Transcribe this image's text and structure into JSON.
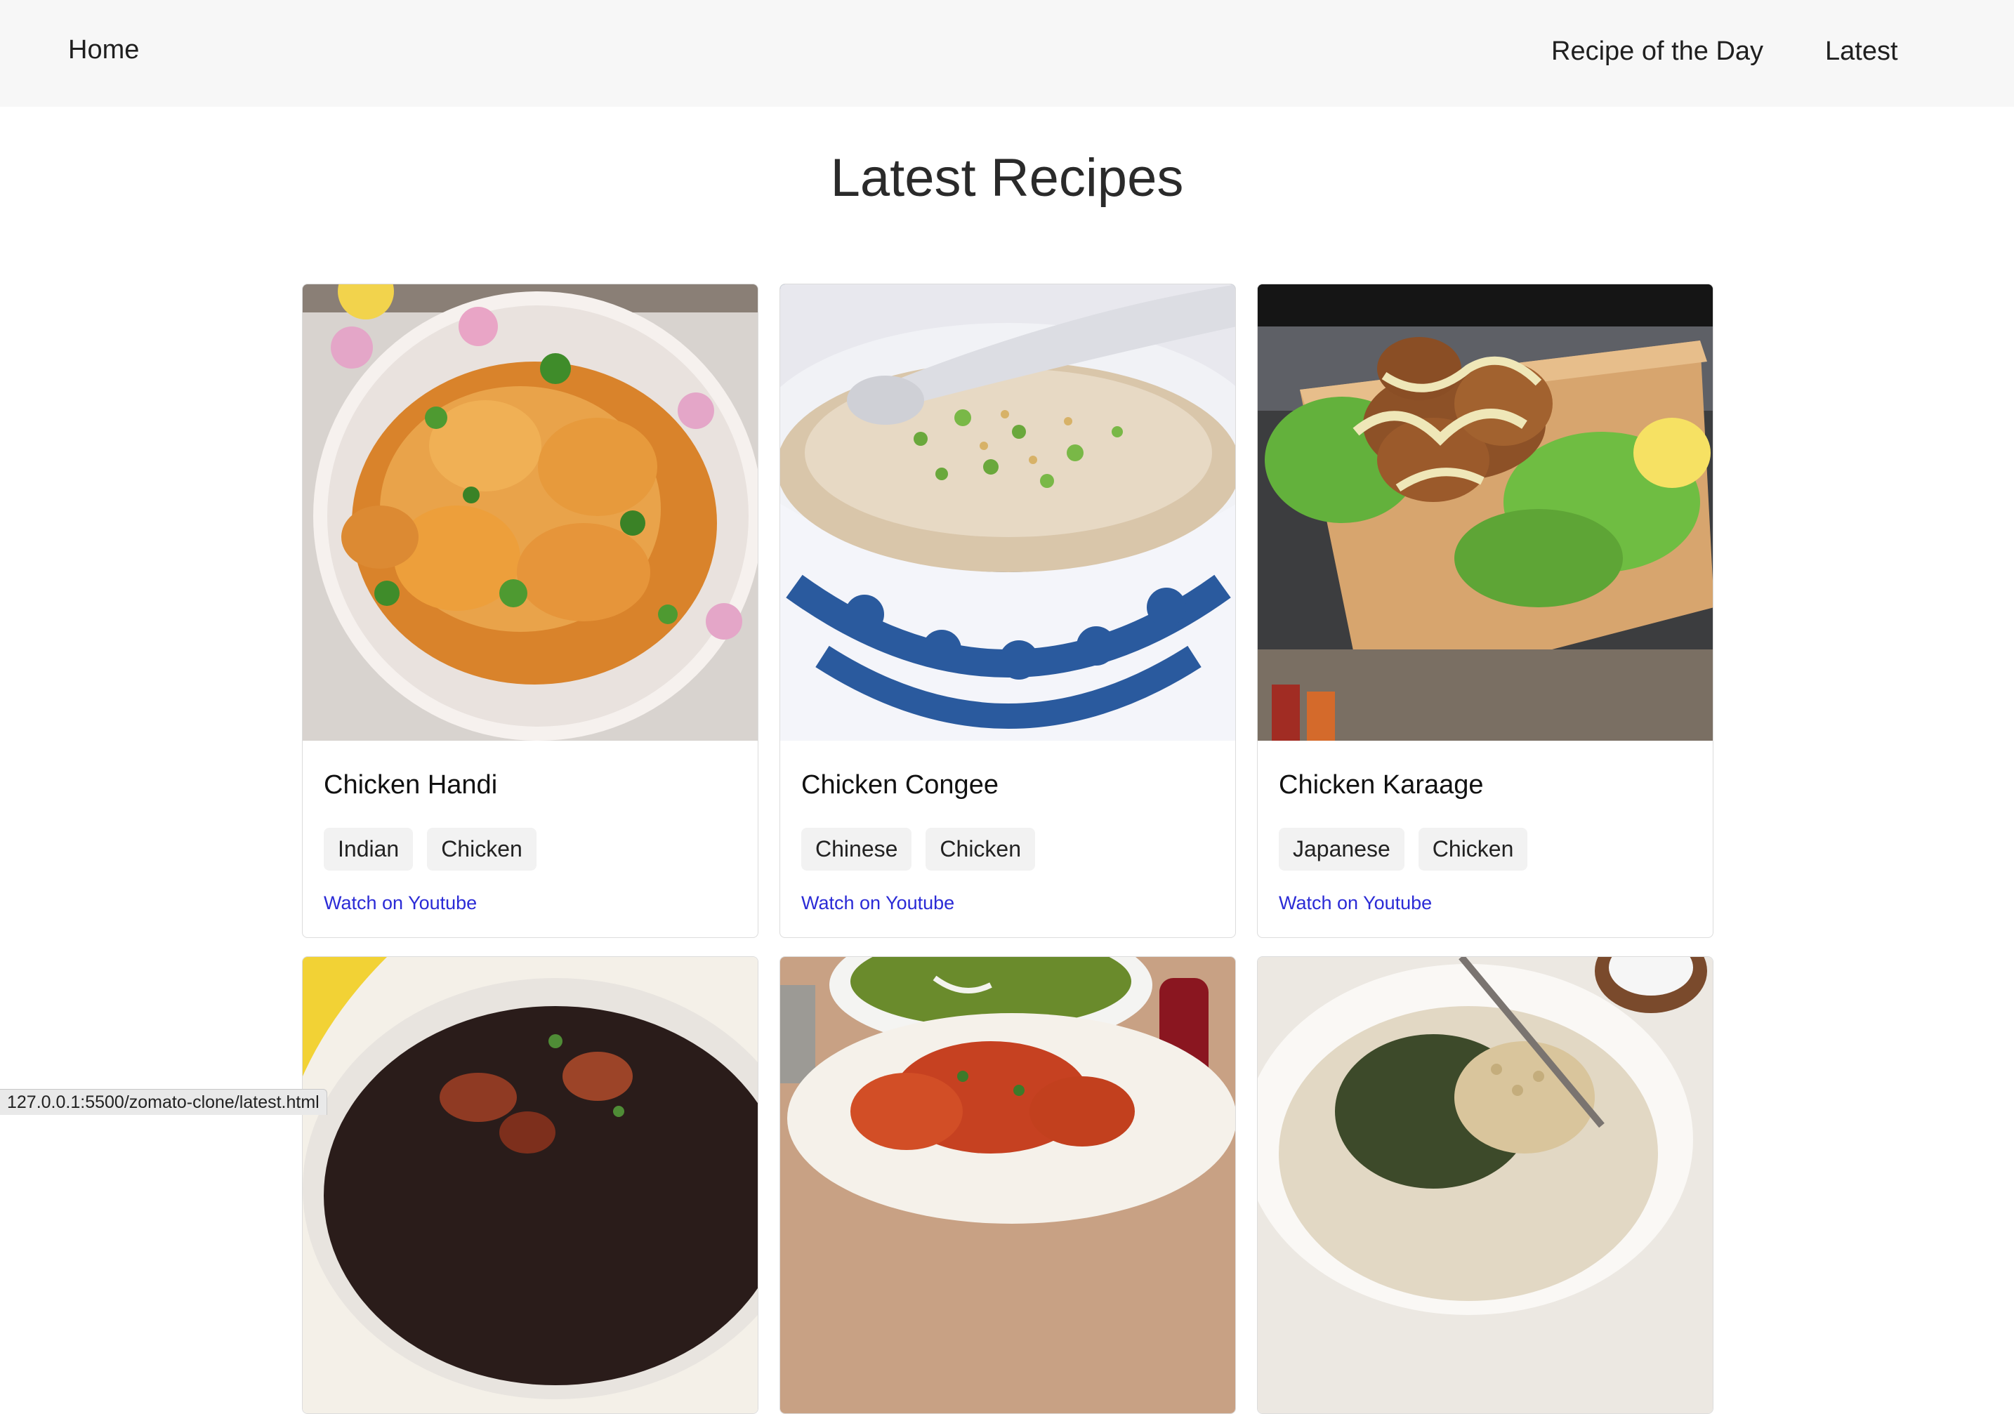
{
  "nav": {
    "home": "Home",
    "recipe_of_the_day": "Recipe of the Day",
    "latest": "Latest"
  },
  "page": {
    "title": "Latest Recipes"
  },
  "recipes": [
    {
      "title": "Chicken Handi",
      "tags": [
        "Indian",
        "Chicken"
      ],
      "link": "Watch on Youtube",
      "image_icon": "curry-dish-image"
    },
    {
      "title": "Chicken Congee",
      "tags": [
        "Chinese",
        "Chicken"
      ],
      "link": "Watch on Youtube",
      "image_icon": "congee-bowl-image"
    },
    {
      "title": "Chicken Karaage",
      "tags": [
        "Japanese",
        "Chicken"
      ],
      "link": "Watch on Youtube",
      "image_icon": "fried-chicken-image"
    }
  ],
  "second_row_images": [
    "dutch-oven-image",
    "tandoori-platter-image",
    "bean-dish-image"
  ],
  "status_bar": {
    "url": "127.0.0.1:5500/zomato-clone/latest.html"
  },
  "colors": {
    "navbar_bg": "#f7f7f7",
    "link": "#2b2bd6",
    "tag_bg": "#f2f2f2"
  }
}
